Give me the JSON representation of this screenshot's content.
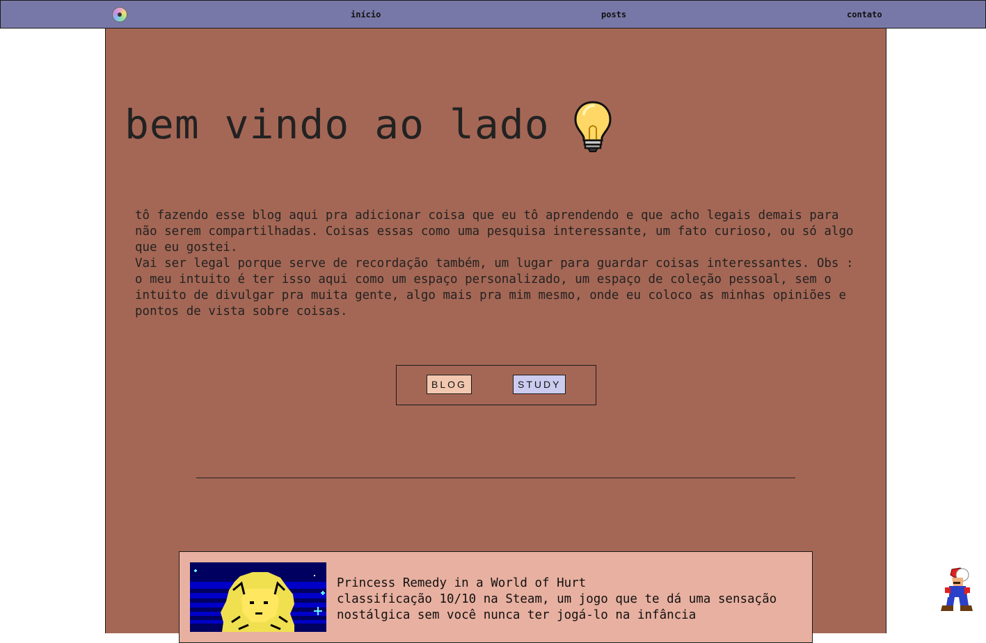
{
  "nav": {
    "logo_icon": "cd-disc-icon",
    "links": [
      {
        "label": "início"
      },
      {
        "label": "posts"
      },
      {
        "label": "contato"
      }
    ]
  },
  "hero": {
    "title": "bem vindo ao lado",
    "icon": "lightbulb-icon"
  },
  "intro": {
    "paragraph1": "tô fazendo esse blog aqui pra adicionar coisa que eu tô aprendendo e que acho legais demais para não serem compartilhadas. Coisas essas como uma pesquisa interessante, um fato curioso, ou só algo que eu gostei.",
    "paragraph2": "Vai ser legal porque serve de recordação também, um lugar para guardar coisas interessantes. Obs : o meu intuito é ter isso aqui como um espaço personalizado, um espaço de coleção pessoal, sem o intuito de divulgar pra muita gente, algo mais pra mim mesmo, onde eu coloco as minhas opiniões e pontos de vista sobre coisas."
  },
  "buttons": {
    "blog": "BLOG",
    "study": "STUDY"
  },
  "post": {
    "title": "Princess Remedy in a World of Hurt",
    "description": "classificação 10/10 na Steam, um jogo que te dá uma sensação nostálgica sem você nunca ter jogá-lo na infância",
    "thumbnail_icon": "princess-remedy-pixel-art"
  },
  "colors": {
    "nav_bg": "#7878a8",
    "main_bg": "#a56755",
    "card_bg": "#e8b0a0",
    "blog_btn": "#f3c8b0",
    "study_btn": "#ccccf0"
  },
  "decor": {
    "mascot_icon": "mario-sprite-icon"
  }
}
